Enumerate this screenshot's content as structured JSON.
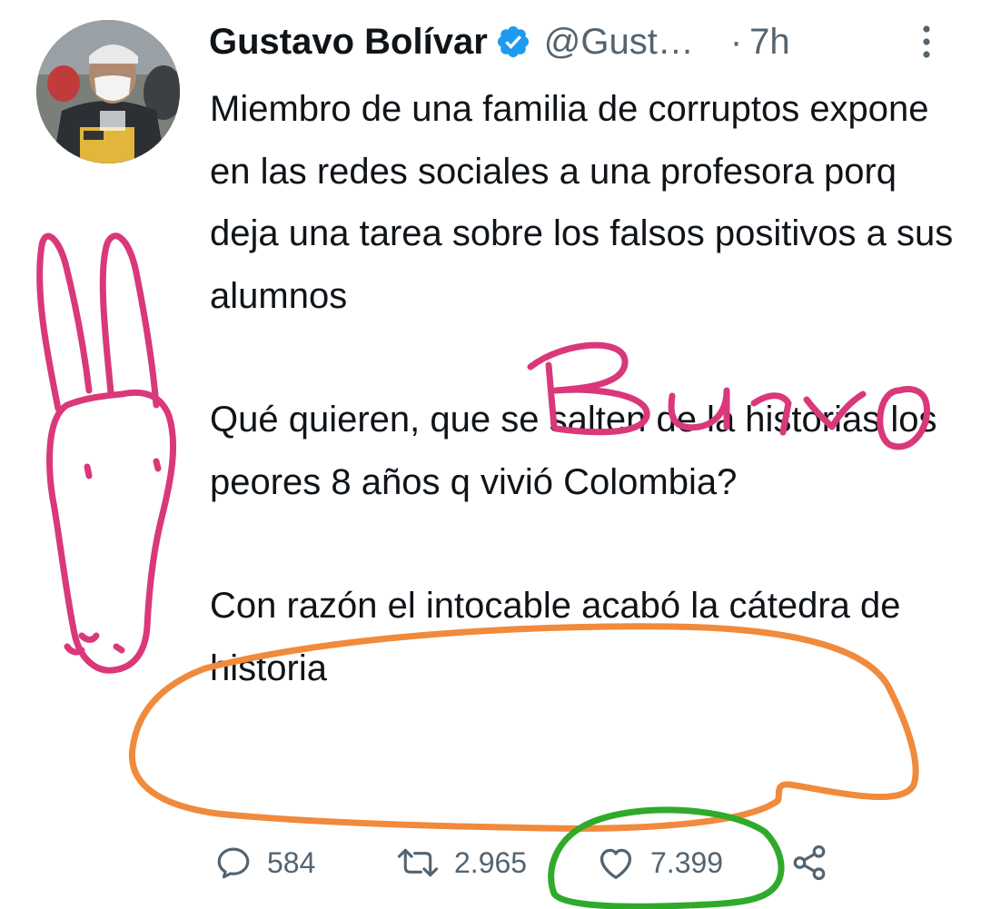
{
  "tweet": {
    "display_name": "Gustavo Bolívar",
    "handle": "@Gust…",
    "separator": "·",
    "time": "7h",
    "paragraphs": [
      "Miembro de una familia de corruptos expone en las redes sociales a una profesora porq deja una tarea sobre los falsos positivos a sus alumnos",
      "Qué quieren, que se salten de la historias los peores 8 años q vivió Colombia?",
      "Con razón el intocable acabó la cátedra de historia"
    ],
    "stats": {
      "replies": "584",
      "retweets": "2.965",
      "likes": "7.399"
    }
  },
  "annotations": {
    "drawn_word": "Burro",
    "colors": {
      "pink": "#d9387a",
      "orange": "#f08a3c",
      "green": "#2faa2a"
    }
  },
  "icons": {
    "verified": "verified-badge-icon",
    "more": "more-vertical-icon",
    "reply": "reply-icon",
    "retweet": "retweet-icon",
    "like": "heart-icon",
    "share": "share-icon"
  },
  "colors": {
    "text": "#0f1419",
    "secondary": "#536471",
    "verified_blue": "#1d9bf0"
  }
}
